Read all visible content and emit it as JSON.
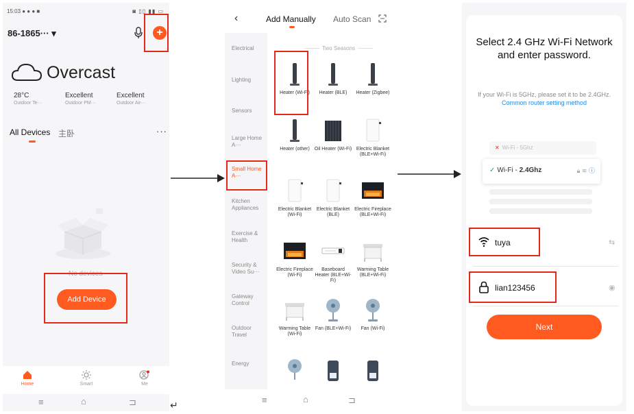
{
  "panel1": {
    "status_time": "15:03 ● ● ● ■",
    "status_right": "◙ ▯▯ ▮▮ ▭",
    "home_name": "86-1865··· ▾",
    "weather": "Overcast",
    "stats": [
      {
        "value": "28°C",
        "label": "Outdoor Te···"
      },
      {
        "value": "Excellent",
        "label": "Outdoor PM···"
      },
      {
        "value": "Excellent",
        "label": "Outdoor Air···"
      }
    ],
    "tab_all": "All Devices",
    "tab_room": "主卧",
    "more": "···",
    "no_devices": "No devices",
    "add_device": "Add Device",
    "nav": [
      {
        "label": "Home",
        "icon": "home-icon"
      },
      {
        "label": "Smart",
        "icon": "sun-icon"
      },
      {
        "label": "Me",
        "icon": "user-icon"
      }
    ],
    "sys": [
      "≡",
      "⌂",
      "⊐"
    ]
  },
  "panel2": {
    "back": "‹",
    "tab_manual": "Add Manually",
    "tab_auto": "Auto Scan",
    "categories": [
      "Electrical",
      "Lighting",
      "Sensors",
      "Large Home A···",
      "Small Home A···",
      "Kitchen Appliances",
      "Exercise & Health",
      "Security & Video Su···",
      "Gateway Control",
      "Outdoor Travel",
      "Energy"
    ],
    "section": "Two Seasons",
    "devices": [
      "Heater (Wi-Fi)",
      "Heater (BLE)",
      "Heater (Zigbee)",
      "Heater (other)",
      "Oil Heater (Wi-Fi)",
      "Electric Blanket (BLE+Wi-Fi)",
      "Electric Blanket (Wi-Fi)",
      "Electric Blanket (BLE)",
      "Electric Fireplace (BLE+Wi-Fi)",
      "Electric Fireplace (Wi-Fi)",
      "Baseboard Heater (BLE+Wi-Fi)",
      "Warming Table (BLE+Wi-Fi)",
      "Warming Table (Wi-Fi)",
      "Fan (BLE+Wi-Fi)",
      "Fan (Wi-Fi)"
    ],
    "sys": [
      "≡",
      "⌂",
      "⊐"
    ]
  },
  "panel3": {
    "title": "Select 2.4 GHz Wi-Fi Network and enter password.",
    "desc": "If your Wi-Fi is 5GHz, please set it to be 2.4GHz.",
    "link": "Common router setting method",
    "wifi5_prefix": "Wi-Fi - ",
    "wifi5_band": "5Ghz",
    "wifi24_prefix": "Wi-Fi - ",
    "wifi24_band": "2.4Ghz",
    "ssid": "tuya",
    "password": "lian123456",
    "next": "Next"
  },
  "accent_color": "#ff5a1f",
  "highlight_color": "#e8261c",
  "return_glyph": "↵"
}
